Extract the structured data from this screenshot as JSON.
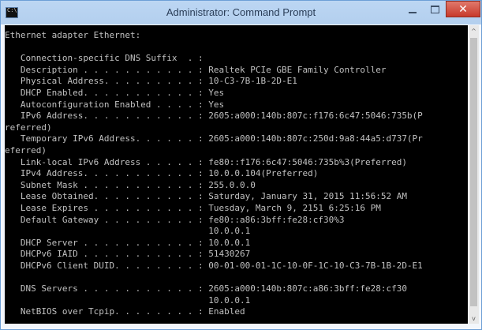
{
  "window": {
    "title": "Administrator: Command Prompt",
    "icons": {
      "app": "cmd-icon",
      "minimize": "minimize-icon",
      "maximize": "maximize-icon",
      "close": "close-icon"
    },
    "close_glyph": "✕",
    "close_color": "#c8392a"
  },
  "console": {
    "text_color": "#c0c0c0",
    "background": "#000000",
    "lines": [
      "Ethernet adapter Ethernet:",
      "",
      "   Connection-specific DNS Suffix  . :",
      "   Description . . . . . . . . . . . : Realtek PCIe GBE Family Controller",
      "   Physical Address. . . . . . . . . : 10-C3-7B-1B-2D-E1",
      "   DHCP Enabled. . . . . . . . . . . : Yes",
      "   Autoconfiguration Enabled . . . . : Yes",
      "   IPv6 Address. . . . . . . . . . . : 2605:a000:140b:807c:f176:6c47:5046:735b(P",
      "referred)",
      "   Temporary IPv6 Address. . . . . . : 2605:a000:140b:807c:250d:9a8:44a5:d737(Pr",
      "eferred)",
      "   Link-local IPv6 Address . . . . . : fe80::f176:6c47:5046:735b%3(Preferred)",
      "   IPv4 Address. . . . . . . . . . . : 10.0.0.104(Preferred)",
      "   Subnet Mask . . . . . . . . . . . : 255.0.0.0",
      "   Lease Obtained. . . . . . . . . . : Saturday, January 31, 2015 11:56:52 AM",
      "   Lease Expires . . . . . . . . . . : Tuesday, March 9, 2151 6:25:16 PM",
      "   Default Gateway . . . . . . . . . : fe80::a86:3bff:fe28:cf30%3",
      "                                       10.0.0.1",
      "   DHCP Server . . . . . . . . . . . : 10.0.0.1",
      "   DHCPv6 IAID . . . . . . . . . . . : 51430267",
      "   DHCPv6 Client DUID. . . . . . . . : 00-01-00-01-1C-10-0F-1C-10-C3-7B-1B-2D-E1",
      "",
      "   DNS Servers . . . . . . . . . . . : 2605:a000:140b:807c:a86:3bff:fe28:cf30",
      "                                       10.0.0.1",
      "   NetBIOS over Tcpip. . . . . . . . : Enabled"
    ]
  },
  "scrollbar": {
    "up_glyph": "^",
    "down_glyph": "v"
  }
}
